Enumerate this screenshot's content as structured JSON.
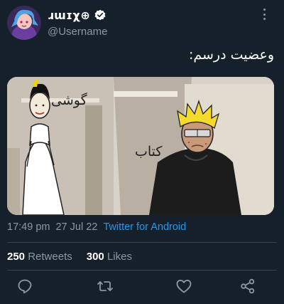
{
  "author": {
    "display_name": "ɹɯɪχ⊕",
    "handle": "@Username",
    "avatar_icon": "avatar-character-icon",
    "verified_icon": "verified-badge-icon"
  },
  "tweet": {
    "text": "وعضیت درسم:",
    "media": {
      "labels": {
        "left": "گوشی",
        "right": "کتاب"
      }
    },
    "time": "17:49 pm",
    "date": "27 Jul 22",
    "source": "Twitter for Android"
  },
  "stats": {
    "retweets_count": "250",
    "retweets_label": "Retweets",
    "likes_count": "300",
    "likes_label": "Likes"
  },
  "actions": {
    "reply_icon": "reply-icon",
    "retweet_icon": "retweet-icon",
    "like_icon": "heart-icon",
    "share_icon": "share-icon"
  },
  "colors": {
    "background": "#15202b",
    "secondary_text": "#8b98a5",
    "link": "#1d9bf0",
    "divider": "#38444d"
  }
}
